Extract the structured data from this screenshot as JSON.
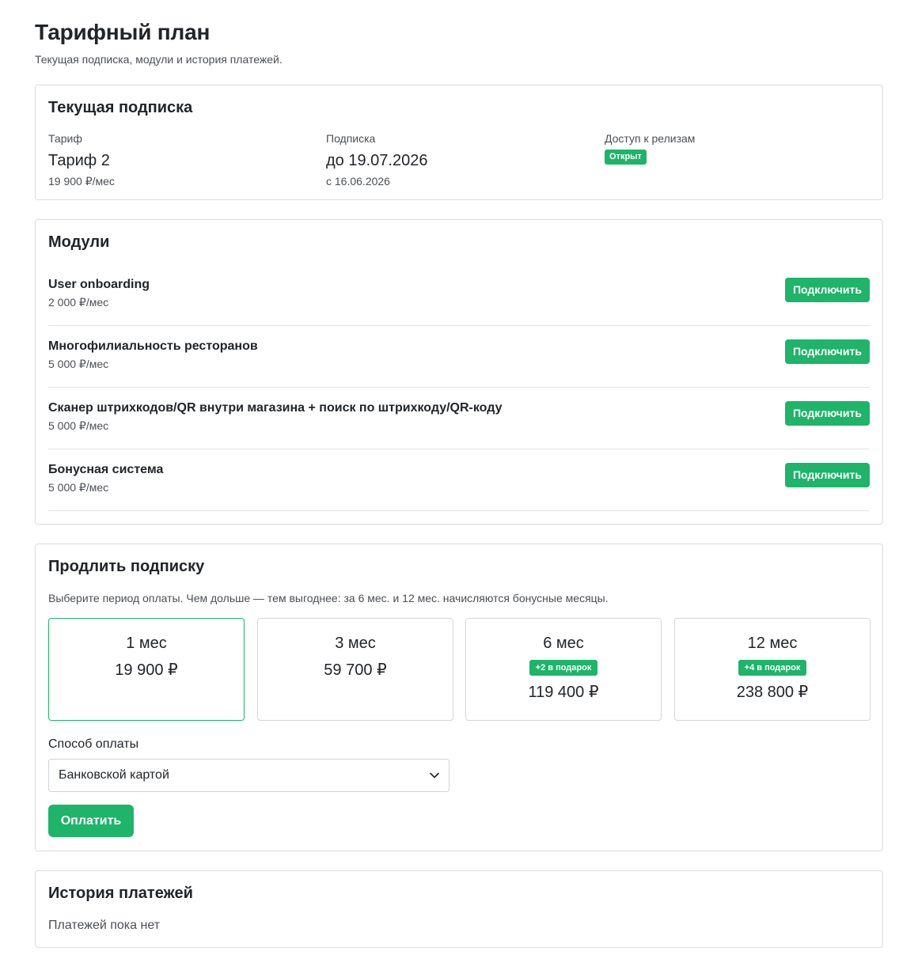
{
  "page": {
    "title": "Тарифный план",
    "subtitle": "Текущая подписка, модули и история платежей."
  },
  "current": {
    "heading": "Текущая подписка",
    "tariff": {
      "label": "Тариф",
      "value": "Тариф 2",
      "note": "19 900 ₽/мес"
    },
    "subscription": {
      "label": "Подписка",
      "value": "до 19.07.2026",
      "note": "с 16.06.2026"
    },
    "releases": {
      "label": "Доступ к релизам",
      "badge": "Открыт"
    }
  },
  "modules": {
    "heading": "Модули",
    "items": [
      {
        "name": "User onboarding",
        "price": "2 000 ₽/мес",
        "button": "Подключить"
      },
      {
        "name": "Многофилиальность ресторанов",
        "price": "5 000 ₽/мес",
        "button": "Подключить"
      },
      {
        "name": "Сканер штрихкодов/QR внутри магазина + поиск по штрихкоду/QR-коду",
        "price": "5 000 ₽/мес",
        "button": "Подключить"
      },
      {
        "name": "Бонусная система",
        "price": "5 000 ₽/мес",
        "button": "Подключить"
      }
    ]
  },
  "extend": {
    "heading": "Продлить подписку",
    "description": "Выберите период оплаты. Чем дольше — тем выгоднее: за 6 мес. и 12 мес. начисляются бонусные месяцы.",
    "periods": [
      {
        "label": "1 мес",
        "price": "19 900 ₽",
        "selected": true
      },
      {
        "label": "3 мес",
        "price": "59 700 ₽"
      },
      {
        "label": "6 мес",
        "bonus": "+2 в подарок",
        "price": "119 400 ₽"
      },
      {
        "label": "12 мес",
        "bonus": "+4 в подарок",
        "price": "238 800 ₽"
      }
    ],
    "payment_method_label": "Способ оплаты",
    "payment_method_value": "Банковской картой",
    "pay_button": "Оплатить"
  },
  "history": {
    "heading": "История платежей",
    "empty": "Платежей пока нет"
  },
  "colors": {
    "accent": "#1eb46a",
    "border": "#d9dcdf",
    "text": "#212529",
    "muted": "#4b4f54"
  }
}
